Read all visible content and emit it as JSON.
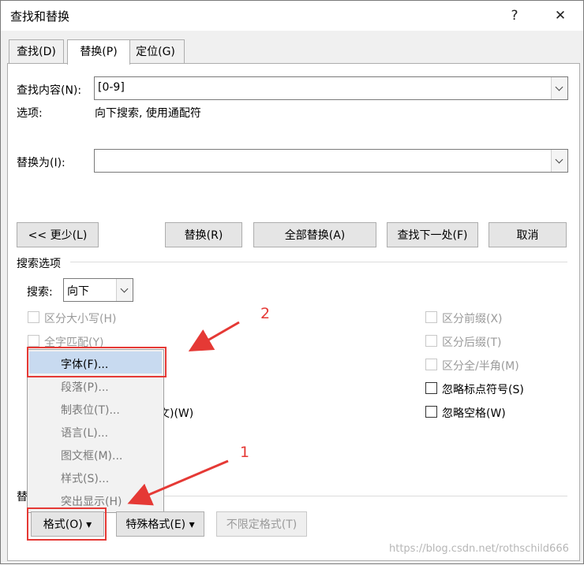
{
  "window": {
    "title": "查找和替换",
    "help": "?",
    "close": "✕"
  },
  "tabs": [
    {
      "label": "查找(D)",
      "active": false
    },
    {
      "label": "替换(P)",
      "active": true
    },
    {
      "label": "定位(G)",
      "active": false
    }
  ],
  "find": {
    "label": "查找内容(N):",
    "value": "[0-9]",
    "options_label": "选项:",
    "options_value": "向下搜索, 使用通配符"
  },
  "replace": {
    "label": "替换为(I):",
    "value": ""
  },
  "buttons": {
    "less": "<< 更少(L)",
    "replace": "替换(R)",
    "replace_all": "全部替换(A)",
    "find_next": "查找下一处(F)",
    "cancel": "取消"
  },
  "search_options": {
    "section_label": "搜索选项",
    "direction_label": "搜索:",
    "direction_value": "向下",
    "left_checks": [
      {
        "label": "区分大小写(H)",
        "enabled": false,
        "checked": false
      },
      {
        "label": "全字匹配(Y)",
        "enabled": false,
        "checked": false
      }
    ],
    "partial_text": "文)(W)",
    "right_checks": [
      {
        "label": "区分前缀(X)",
        "enabled": false,
        "checked": false
      },
      {
        "label": "区分后缀(T)",
        "enabled": false,
        "checked": false
      },
      {
        "label": "区分全/半角(M)",
        "enabled": false,
        "checked": false
      },
      {
        "label": "忽略标点符号(S)",
        "enabled": true,
        "checked": false
      },
      {
        "label": "忽略空格(W)",
        "enabled": true,
        "checked": false
      }
    ]
  },
  "replace_section_partial": "替",
  "format_menu": {
    "items": [
      "字体(F)...",
      "段落(P)...",
      "制表位(T)...",
      "语言(L)...",
      "图文框(M)...",
      "样式(S)...",
      "突出显示(H)"
    ],
    "highlighted_index": 0
  },
  "bottom_buttons": {
    "format": "格式(O)",
    "special": "特殊格式(E)",
    "no_format": "不限定格式(T)"
  },
  "annotations": {
    "num1": "1",
    "num2": "2",
    "color": "#e53935"
  },
  "watermark": "https://blog.csdn.net/rothschild666"
}
